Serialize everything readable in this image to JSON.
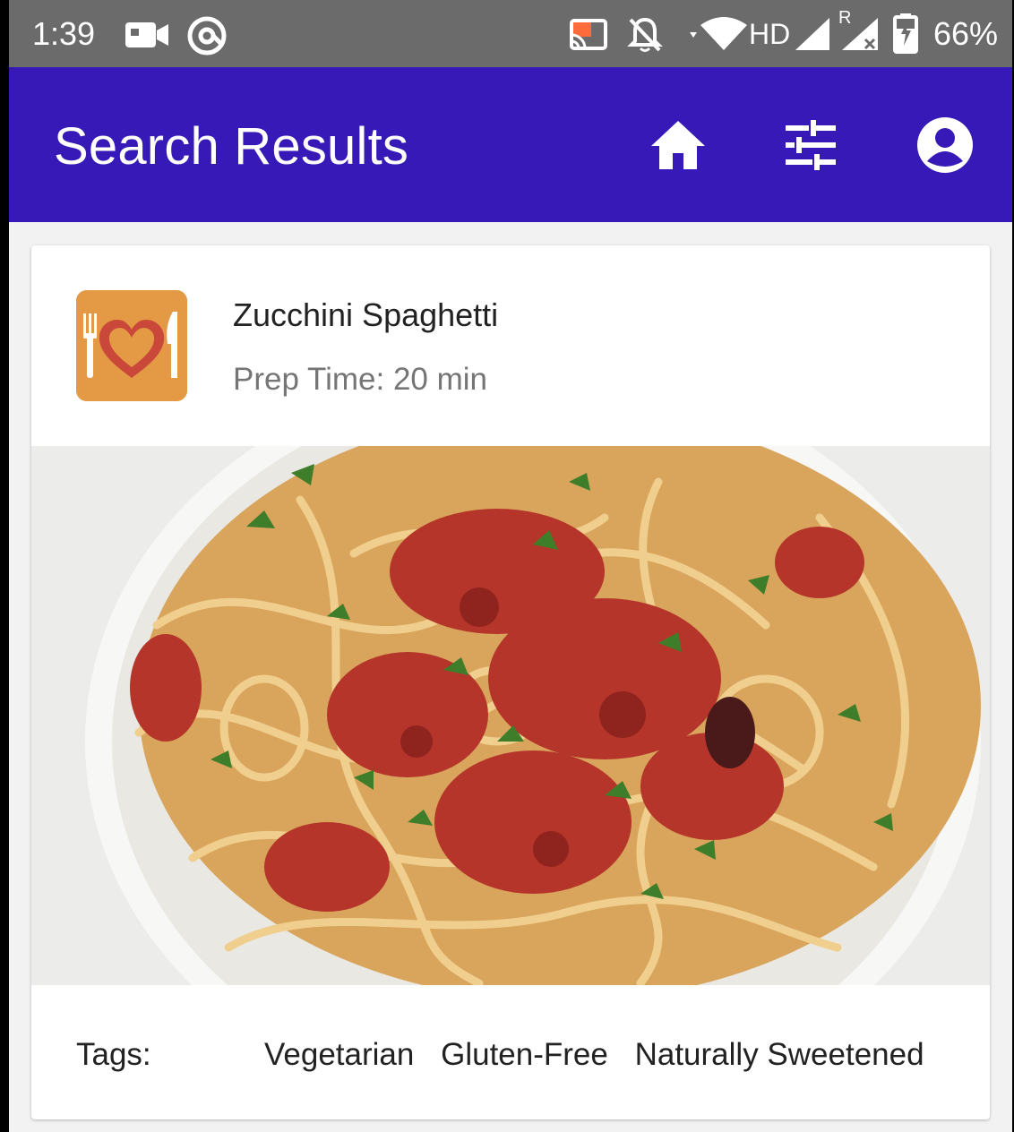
{
  "status_bar": {
    "time": "1:39",
    "battery": "66%",
    "icons": [
      "video-camera-icon",
      "at-sign-icon",
      "cast-icon",
      "bell-off-icon",
      "wifi-icon",
      "hd-label",
      "signal-icon",
      "roaming-signal-icon",
      "battery-charging-icon"
    ],
    "hd_label": "HD",
    "roaming_label": "R"
  },
  "app_bar": {
    "title": "Search Results",
    "background": "#3619b6",
    "actions": [
      "home-icon",
      "tune-icon",
      "account-icon"
    ]
  },
  "result_card": {
    "avatar_icon": "fork-heart-knife-icon",
    "avatar_color": "#e49a45",
    "recipe_name": "Zucchini Spaghetti",
    "prep_time": "Prep Time: 20 min",
    "photo": "zucchini-spaghetti-photo",
    "tags_label": "Tags:",
    "tags": [
      "Vegetarian",
      "Gluten-Free",
      "Naturally Sweetened"
    ]
  }
}
